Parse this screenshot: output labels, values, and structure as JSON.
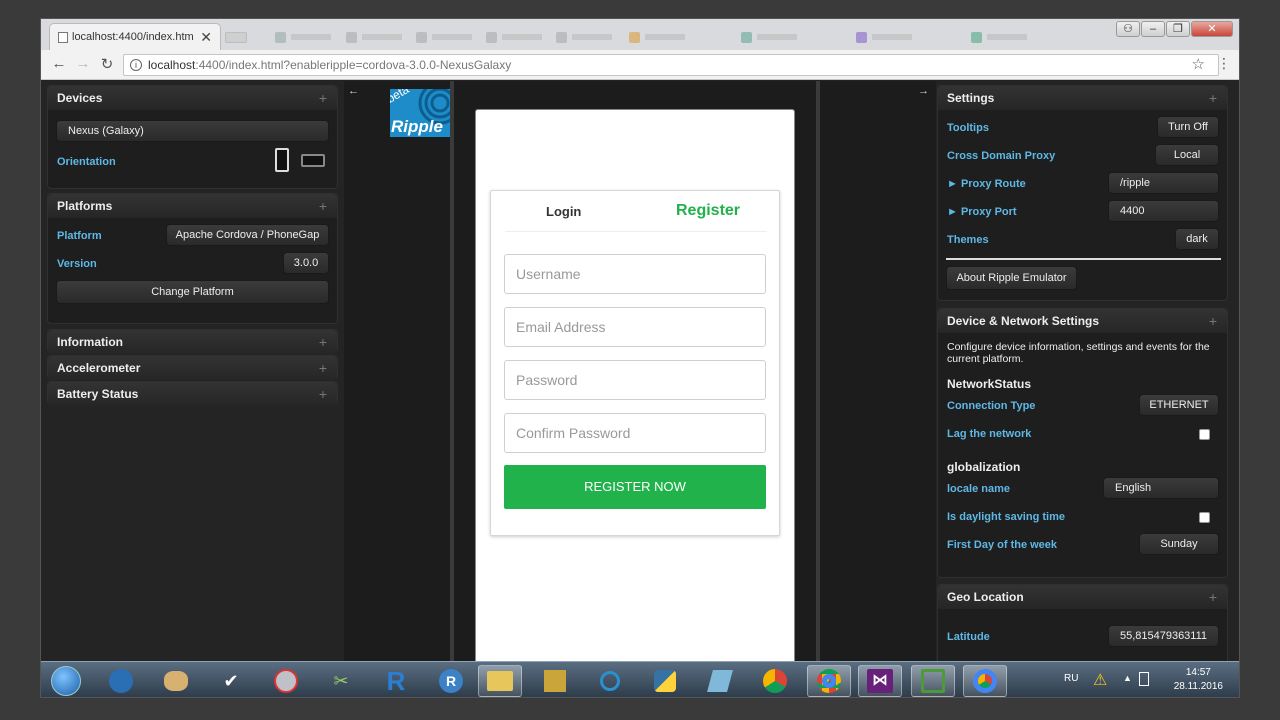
{
  "browser": {
    "active_tab_title": "localhost:4400/index.htm",
    "url_host": "localhost",
    "url_rest": ":4400/index.html?enableripple=cordova-3.0.0-NexusGalaxy"
  },
  "left": {
    "devices": {
      "title": "Devices",
      "device": "Nexus (Galaxy)",
      "orientation_label": "Orientation"
    },
    "platforms": {
      "title": "Platforms",
      "platform_label": "Platform",
      "platform_value": "Apache Cordova / PhoneGap",
      "version_label": "Version",
      "version_value": "3.0.0",
      "change_button": "Change Platform"
    },
    "information": {
      "title": "Information"
    },
    "accelerometer": {
      "title": "Accelerometer"
    },
    "battery": {
      "title": "Battery Status"
    }
  },
  "logo": {
    "beta": "beta",
    "name": "Ripple"
  },
  "app": {
    "tab_login": "Login",
    "tab_register": "Register",
    "username_placeholder": "Username",
    "email_placeholder": "Email Address",
    "password_placeholder": "Password",
    "confirm_placeholder": "Confirm Password",
    "register_button": "REGISTER NOW",
    "accent_color": "#21b24b"
  },
  "right": {
    "settings": {
      "title": "Settings",
      "tooltips_label": "Tooltips",
      "tooltips_value": "Turn Off",
      "cdp_label": "Cross Domain Proxy",
      "cdp_value": "Local",
      "proxy_route_label": "► Proxy Route",
      "proxy_route_value": "/ripple",
      "proxy_port_label": "► Proxy Port",
      "proxy_port_value": "4400",
      "themes_label": "Themes",
      "themes_value": "dark",
      "about_button": "About Ripple Emulator"
    },
    "device_network": {
      "title": "Device & Network Settings",
      "description": "Configure device information, settings and events for the current platform.",
      "network_heading": "NetworkStatus",
      "connection_label": "Connection Type",
      "connection_value": "ETHERNET",
      "lag_label": "Lag the network",
      "glob_heading": "globalization",
      "locale_label": "locale name",
      "locale_value": "English",
      "dst_label": "Is daylight saving time",
      "firstday_label": "First Day of the week",
      "firstday_value": "Sunday"
    },
    "geo": {
      "title": "Geo Location",
      "lat_label": "Latitude",
      "lat_value": "55,815479363111"
    }
  },
  "taskbar": {
    "lang": "RU",
    "time": "14:57",
    "date": "28.11.2016"
  }
}
